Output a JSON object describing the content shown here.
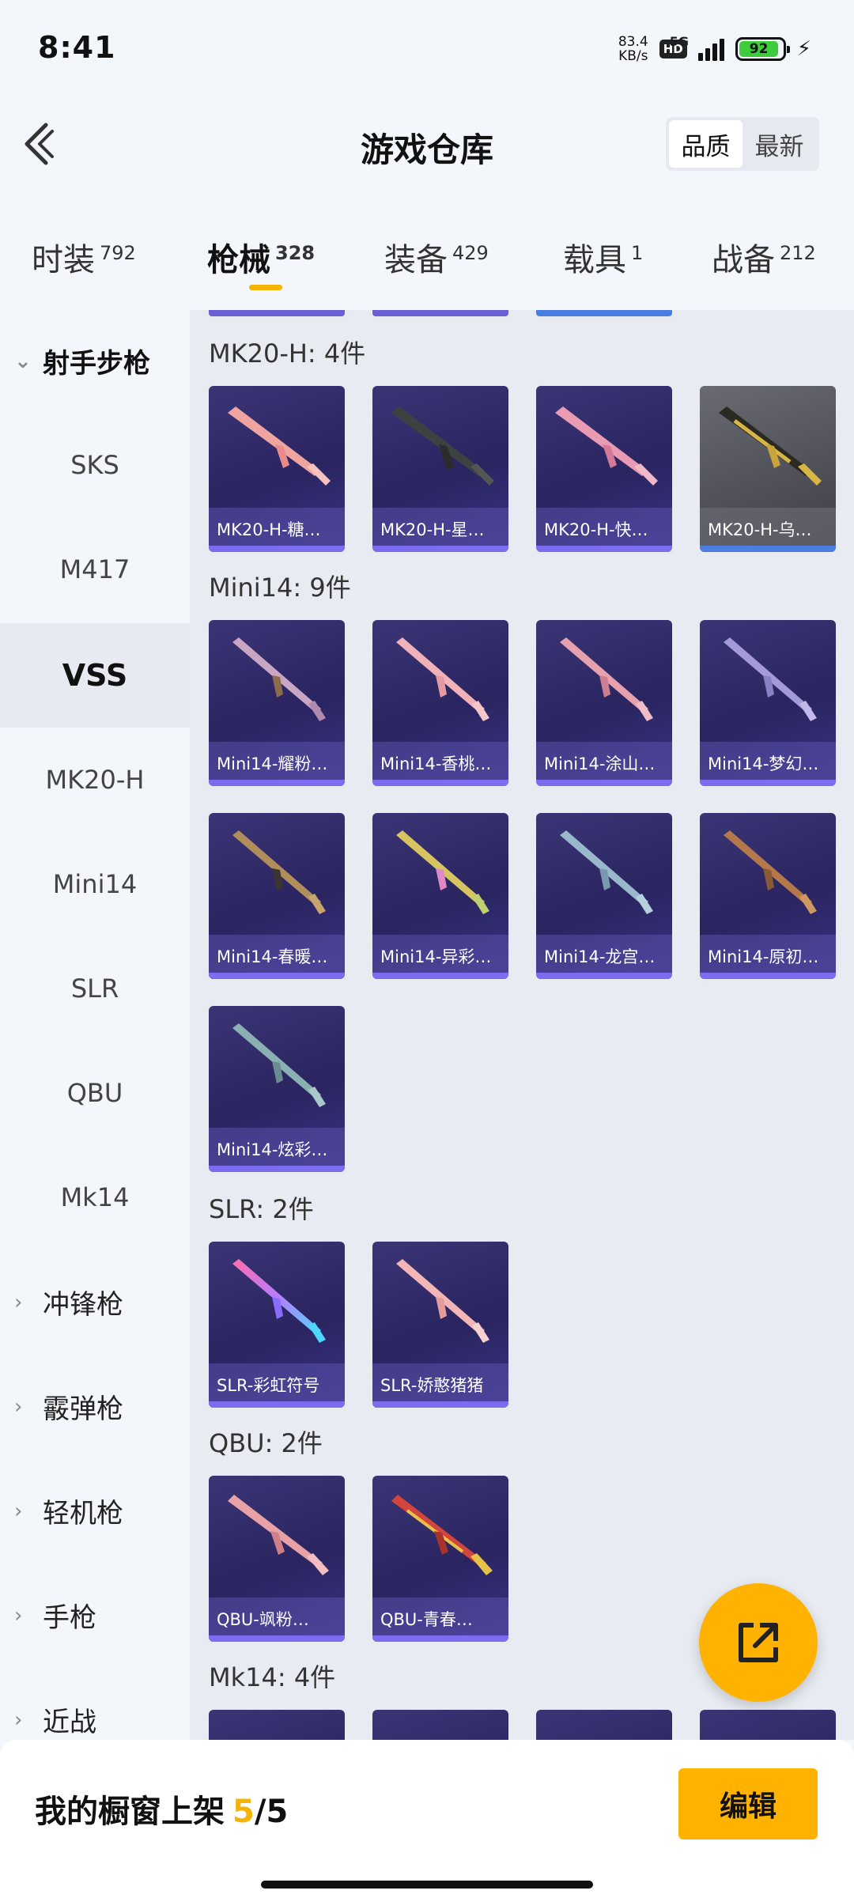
{
  "status": {
    "time": "8:41",
    "net_speed_value": "83.4",
    "net_speed_unit": "KB/s",
    "hd": "HD",
    "network": "5G",
    "battery": "92",
    "battery_level": 0.92
  },
  "header": {
    "title": "游戏仓库",
    "sort_options": [
      "品质",
      "最新"
    ]
  },
  "tabs": [
    {
      "label": "时装",
      "count": "792"
    },
    {
      "label": "枪械",
      "count": "328"
    },
    {
      "label": "装备",
      "count": "429"
    },
    {
      "label": "载具",
      "count": "1"
    },
    {
      "label": "战备",
      "count": "212"
    }
  ],
  "sidebar": {
    "open_category": "射手步枪",
    "sub_items": [
      "SKS",
      "M417",
      "VSS",
      "MK20-H",
      "Mini14",
      "SLR",
      "QBU",
      "Mk14"
    ],
    "categories": [
      "冲锋枪",
      "霰弹枪",
      "轻机枪",
      "手枪",
      "近战"
    ]
  },
  "groups": [
    {
      "title": "MK20-H: 4件",
      "items": [
        "MK20-H-糖…",
        "MK20-H-星…",
        "MK20-H-快…",
        "MK20-H-乌…"
      ]
    },
    {
      "title": "Mini14: 9件",
      "items": [
        "Mini14-耀粉…",
        "Mini14-香桃…",
        "Mini14-涂山…",
        "Mini14-梦幻…",
        "Mini14-春暖…",
        "Mini14-异彩…",
        "Mini14-龙宫…",
        "Mini14-原初…",
        "Mini14-炫彩…"
      ]
    },
    {
      "title": "SLR: 2件",
      "items": [
        "SLR-彩虹符号",
        "SLR-娇憨猪猪"
      ]
    },
    {
      "title": "QBU: 2件",
      "items": [
        "QBU-飒粉…",
        "QBU-青春…"
      ]
    },
    {
      "title": "Mk14: 4件"
    }
  ],
  "footer": {
    "showcase_label": "我的橱窗上架",
    "showcase_current": "5",
    "showcase_total": "/5",
    "edit_label": "编辑"
  },
  "colors": {
    "accent": "#ffb300",
    "card_purple": "#2a2560",
    "card_bar": "#7b6cf0"
  }
}
